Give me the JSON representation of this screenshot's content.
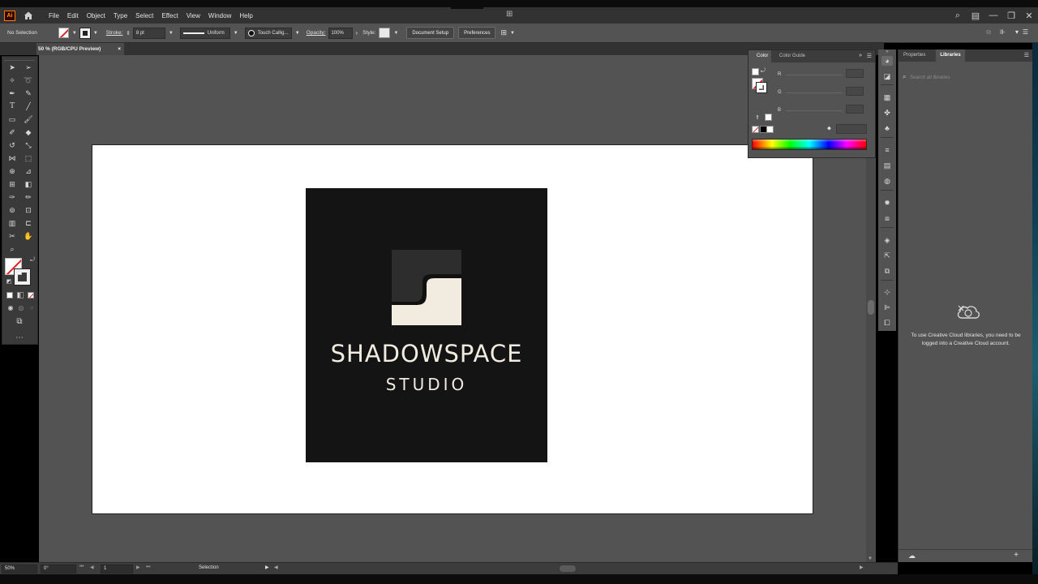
{
  "app": {
    "logo_text": "Ai"
  },
  "menubar": {
    "items": [
      "File",
      "Edit",
      "Object",
      "Type",
      "Select",
      "Effect",
      "View",
      "Window",
      "Help"
    ]
  },
  "controlbar": {
    "selection_label": "No Selection",
    "stroke_label": "Stroke:",
    "stroke_weight": "8 pt",
    "profile": "Uniform",
    "brush": "Touch Callig...",
    "opacity_label": "Opacity:",
    "opacity_value": "100%",
    "style_label": "Style:",
    "document_setup": "Document Setup",
    "preferences": "Preferences"
  },
  "document_tab": {
    "title": "50 % (RGB/CPU Preview)",
    "close": "×"
  },
  "artwork": {
    "title": "SHADOWSPACE",
    "subtitle": "STUDIO",
    "colors": {
      "background": "#141414",
      "cream": "#f1ebe0",
      "dark_gray": "#2d2d2d"
    }
  },
  "color_panel": {
    "tabs": [
      "Color",
      "Color Guide"
    ],
    "channels": [
      "R",
      "G",
      "B"
    ]
  },
  "libraries_panel": {
    "tabs": [
      "Properties",
      "Libraries"
    ],
    "search_placeholder": "Search all libraries",
    "message": "To use Creative Cloud libraries, you need to be logged into a Creative Cloud account."
  },
  "statusbar": {
    "zoom": "50%",
    "rotation": "0°",
    "artboard": "1",
    "tool": "Selection"
  }
}
